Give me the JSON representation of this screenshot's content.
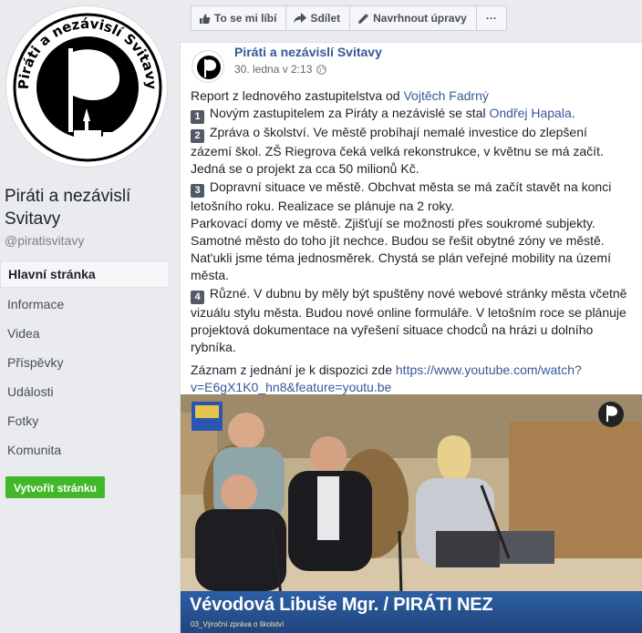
{
  "page": {
    "name": "Piráti a nezávislí Svitavy",
    "handle": "@piratisvitavy",
    "logo_text": "Piráti a nezávislí Svitavy"
  },
  "nav": {
    "items": [
      "Hlavní stránka",
      "Informace",
      "Videa",
      "Příspěvky",
      "Události",
      "Fotky",
      "Komunita"
    ],
    "create_button": "Vytvořit stránku"
  },
  "toolbar": {
    "like": "To se mi líbí",
    "share": "Sdílet",
    "suggest": "Navrhnout úpravy",
    "more": "···"
  },
  "post": {
    "author": "Piráti a nezávislí Svitavy",
    "time": "30. ledna v 2:13",
    "intro_prefix": "Report z lednového zastupitelstva od ",
    "intro_link": "Vojtěch Fadrný",
    "item1_num": "1",
    "item1_prefix": "Novým zastupitelem za Piráty a nezávislé se stal ",
    "item1_link": "Ondřej Hapala",
    "item1_suffix": ".",
    "item2_num": "2",
    "item2_text": "Zpráva o školství. Ve městě probíhají nemalé investice do zlepšení zázemí škol. ZŠ Riegrova čeká velká rekonstrukce, v květnu se má začít. Jedná se o projekt za cca 50 milionů Kč.",
    "item3_num": "3",
    "item3_text": "Dopravní situace ve městě. Obchvat města se má začít stavět na konci letošního roku. Realizace se plánuje na 2 roky.",
    "item3_extra": "Parkovací domy ve městě. Zjišťují se možnosti přes soukromé subjekty. Samotné město do toho jít nechce. Budou se řešit obytné zóny ve městě. Nat'ukli jsme téma jednosměrek. Chystá se plán veřejné mobility na území města.",
    "item4_num": "4",
    "item4_text": "Různé. V dubnu by měly být spuštěny nové webové stránky města včetně vizuálu stylu města. Budou nové online formuláře. V letošním roce se plánuje projektová dokumentace na vyřešení situace chodců na hrázi u dolního rybníka.",
    "record_prefix": "Záznam z jednání je k dispozici zde ",
    "record_link": "https://www.youtube.com/watch?v=E6gX1K0_hn8&feature=youtu.be"
  },
  "video": {
    "caption_title": "Vévodová Libuše Mgr. / PIRÁTI NEZ",
    "caption_sub": "03_Výroční zpráva o školství"
  },
  "colors": {
    "link": "#365899",
    "green": "#42b72a",
    "caption_blue": "#2c5fa4"
  }
}
